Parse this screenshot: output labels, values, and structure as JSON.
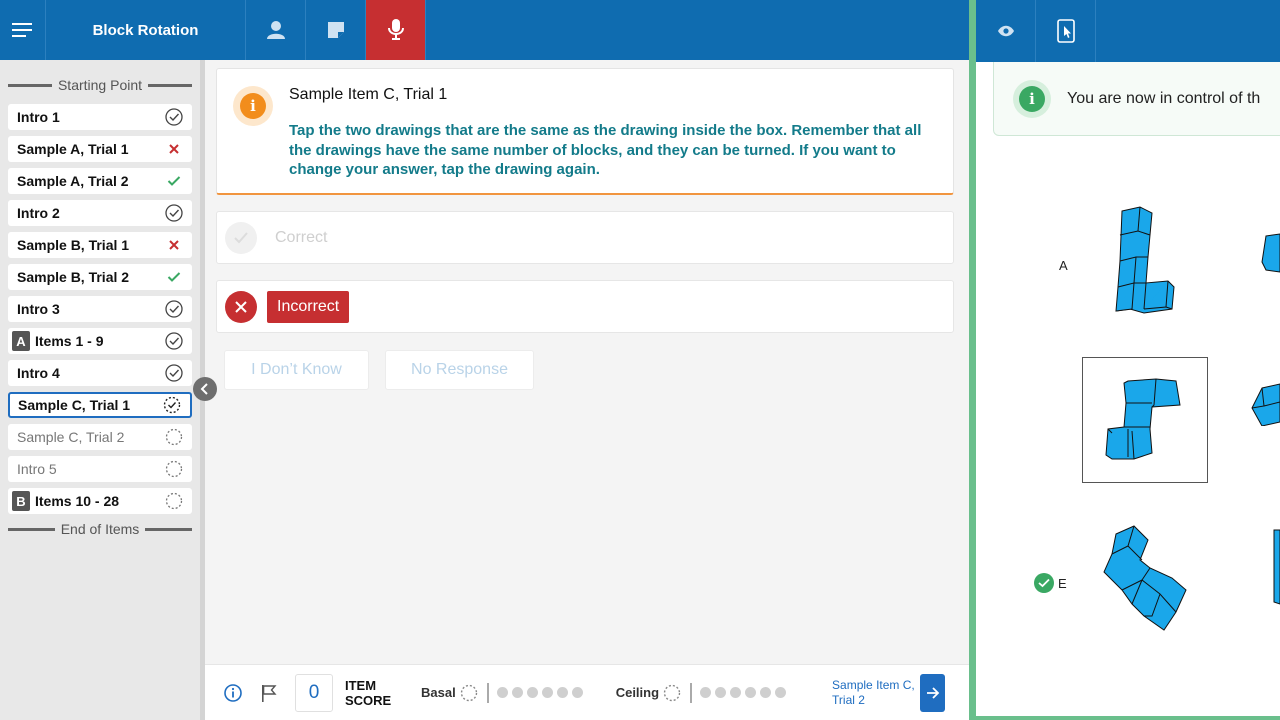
{
  "header": {
    "menu_icon": "menu-icon",
    "title": "Block Rotation",
    "buttons": [
      {
        "name": "examinee-icon"
      },
      {
        "name": "notes-icon"
      },
      {
        "name": "microphone-icon",
        "active": true
      }
    ]
  },
  "sidebar": {
    "start_label": "Starting Point",
    "end_label": "End of Items",
    "items": [
      {
        "label": "Intro 1",
        "status": "done"
      },
      {
        "label": "Sample A, Trial 1",
        "status": "incorrect"
      },
      {
        "label": "Sample A, Trial 2",
        "status": "correct"
      },
      {
        "label": "Intro 2",
        "status": "done"
      },
      {
        "label": "Sample B, Trial 1",
        "status": "incorrect"
      },
      {
        "label": "Sample B, Trial 2",
        "status": "correct"
      },
      {
        "label": "Intro 3",
        "status": "done"
      },
      {
        "label": "Items 1 - 9",
        "badge": "A",
        "status": "done"
      },
      {
        "label": "Intro 4",
        "status": "done"
      },
      {
        "label": "Sample C, Trial 1",
        "status": "current"
      },
      {
        "label": "Sample C, Trial 2",
        "status": "pending"
      },
      {
        "label": "Intro 5",
        "status": "pending"
      },
      {
        "label": "Items 10 - 28",
        "badge": "B",
        "status": "pending-bold"
      }
    ]
  },
  "instruction": {
    "title": "Sample Item C, Trial 1",
    "text": "Tap the two drawings that are the same as the drawing inside the box. Remember that all the drawings have the same number of blocks, and they can be turned. If you want to change your answer, tap the drawing again."
  },
  "responses": {
    "correct_label": "Correct",
    "incorrect_label": "Incorrect",
    "dont_know_label": "I Don’t Know",
    "no_response_label": "No Response"
  },
  "footer": {
    "item_score": "0",
    "item_score_label_1": "ITEM",
    "item_score_label_2": "SCORE",
    "basal_label": "Basal",
    "ceiling_label": "Ceiling",
    "next_item_label": "Sample Item C, Trial 2",
    "dots_count": 6
  },
  "right_panel": {
    "buttons": [
      {
        "name": "eye-icon"
      },
      {
        "name": "tablet-touch-icon"
      }
    ],
    "banner_text": "You are now in control of th",
    "option_labels": {
      "a": "A",
      "e": "E"
    },
    "colors": {
      "block": "#1aa7ea",
      "accent_green": "#3aa863"
    }
  },
  "colors": {
    "header_blue": "#0f6cb0",
    "mic_red": "#c62f31",
    "teal_text": "#137b8a",
    "info_orange": "#f28d1c"
  }
}
